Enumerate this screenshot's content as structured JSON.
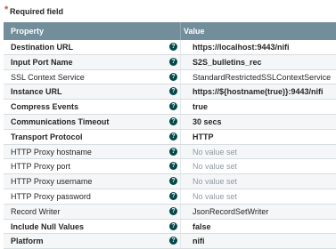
{
  "required_field": {
    "label": "Required field"
  },
  "table": {
    "headers": {
      "property": "Property",
      "value": "Value"
    },
    "rows": [
      {
        "name": "Destination URL",
        "value": "https://localhost:9443/nifi",
        "required": true,
        "empty": false
      },
      {
        "name": "Input Port Name",
        "value": "S2S_bulletins_rec",
        "required": true,
        "empty": false
      },
      {
        "name": "SSL Context Service",
        "value": "StandardRestrictedSSLContextService",
        "required": false,
        "empty": false
      },
      {
        "name": "Instance URL",
        "value": "https://${hostname(true)}:9443/nifi",
        "required": true,
        "empty": false
      },
      {
        "name": "Compress Events",
        "value": "true",
        "required": true,
        "empty": false
      },
      {
        "name": "Communications Timeout",
        "value": "30 secs",
        "required": true,
        "empty": false
      },
      {
        "name": "Transport Protocol",
        "value": "HTTP",
        "required": true,
        "empty": false
      },
      {
        "name": "HTTP Proxy hostname",
        "value": "No value set",
        "required": false,
        "empty": true
      },
      {
        "name": "HTTP Proxy port",
        "value": "No value set",
        "required": false,
        "empty": true
      },
      {
        "name": "HTTP Proxy username",
        "value": "No value set",
        "required": false,
        "empty": true
      },
      {
        "name": "HTTP Proxy password",
        "value": "No value set",
        "required": false,
        "empty": true
      },
      {
        "name": "Record Writer",
        "value": "JsonRecordSetWriter",
        "required": false,
        "empty": false
      },
      {
        "name": "Include Null Values",
        "value": "false",
        "required": true,
        "empty": false
      },
      {
        "name": "Platform",
        "value": "nifi",
        "required": true,
        "empty": false
      }
    ]
  },
  "icons": {
    "help": "help-circle-icon",
    "help_glyph": "?"
  },
  "colors": {
    "header_bg": "#728e9b",
    "help_icon": "#004849",
    "empty_value": "#8f9ba3"
  }
}
